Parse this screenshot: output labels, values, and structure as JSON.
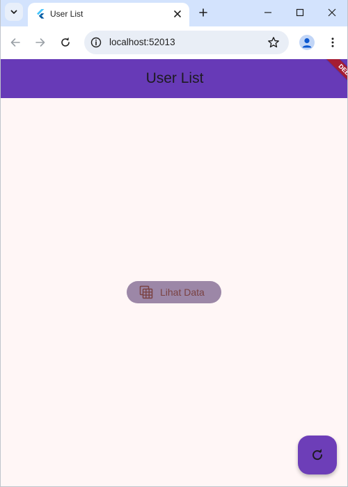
{
  "browser": {
    "tab": {
      "title": "User List"
    },
    "address_bar": {
      "url": "localhost:52013"
    }
  },
  "app": {
    "appbar": {
      "title": "User List"
    },
    "debug_banner": {
      "label": "DEBUG"
    },
    "main_button": {
      "label": "Lihat Data",
      "icon": "table-icon"
    },
    "fab": {
      "icon": "refresh-icon"
    },
    "colors": {
      "appbar": "#673ab7",
      "background": "#fff6f6",
      "button": "#9c87a7",
      "fab": "#6d3eb8",
      "debug": "#a51d33"
    }
  }
}
